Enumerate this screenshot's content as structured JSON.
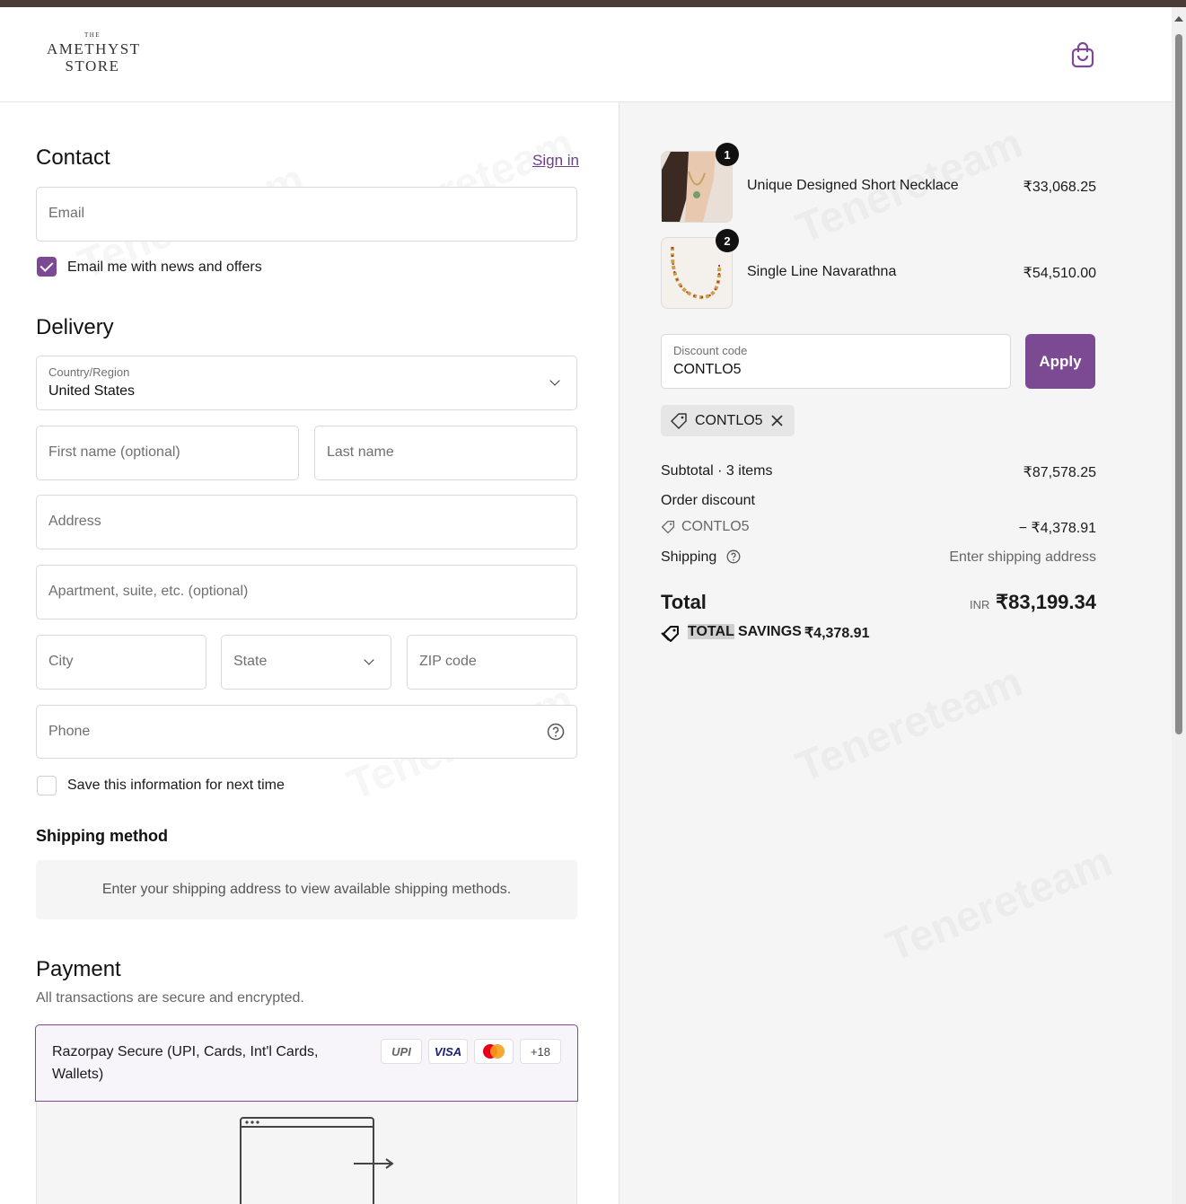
{
  "store": {
    "logo_the": "THE",
    "logo_line1": "AMETHYST",
    "logo_line2": "STORE"
  },
  "contact": {
    "title": "Contact",
    "sign_in": "Sign in",
    "email_placeholder": "Email",
    "newsletter_label": "Email me with news and offers",
    "newsletter_checked": true
  },
  "delivery": {
    "title": "Delivery",
    "country_label": "Country/Region",
    "country_value": "United States",
    "first_name_placeholder": "First name (optional)",
    "last_name_placeholder": "Last name",
    "address_placeholder": "Address",
    "apartment_placeholder": "Apartment, suite, etc. (optional)",
    "city_placeholder": "City",
    "state_placeholder": "State",
    "zip_placeholder": "ZIP code",
    "phone_placeholder": "Phone",
    "save_info_label": "Save this information for next time",
    "save_info_checked": false
  },
  "shipping_method": {
    "title": "Shipping method",
    "message": "Enter your shipping address to view available shipping methods."
  },
  "payment": {
    "title": "Payment",
    "subtitle": "All transactions are secure and encrypted.",
    "option_label_line1": "Razorpay Secure (UPI, Cards, Int'l Cards,",
    "option_label_line2": "Wallets)",
    "badges": {
      "upi": "UPI",
      "visa": "VISA",
      "more": "+18"
    }
  },
  "cart": {
    "items": [
      {
        "name": "Unique Designed Short Necklace",
        "price": "₹33,068.25",
        "quantity": "1"
      },
      {
        "name": "Single Line Navarathna",
        "price": "₹54,510.00",
        "quantity": "2"
      }
    ],
    "discount_label": "Discount code",
    "discount_value": "CONTLO5",
    "apply_label": "Apply",
    "applied_code": "CONTLO5",
    "subtotal_label": "Subtotal · 3 items",
    "subtotal_value": "₹87,578.25",
    "order_discount_label": "Order discount",
    "order_discount_code": "CONTLO5",
    "order_discount_value": "− ₹4,378.91",
    "shipping_label": "Shipping",
    "shipping_value": "Enter shipping address",
    "total_label": "Total",
    "total_currency": "INR",
    "total_value": "₹83,199.34",
    "savings_label_a": "TOTAL",
    "savings_label_b": " SAVINGS",
    "savings_value": "₹4,378.91"
  },
  "watermark": "Tenereteam",
  "colors": {
    "accent": "#7b4a93",
    "topbar": "#4a3a38"
  }
}
